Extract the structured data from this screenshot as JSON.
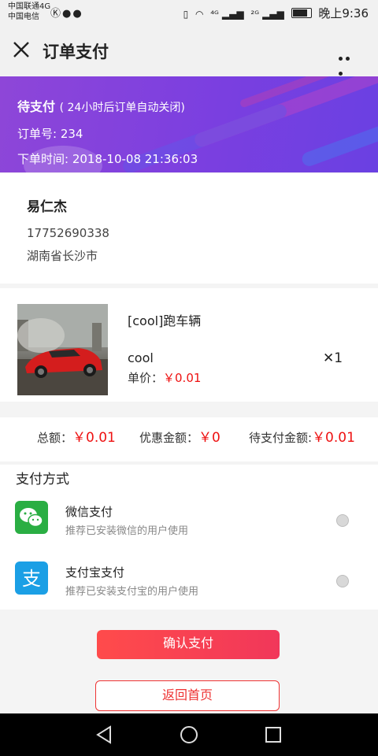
{
  "status_bar": {
    "carrier1": "中国联通4G",
    "carrier2": "中国电信",
    "time": "晚上9:36",
    "signal1": "⁴ᴳ",
    "signal2": "²ᴳ"
  },
  "header": {
    "title": "订单支付"
  },
  "banner": {
    "status": "待支付",
    "status_note": "( 24小时后订单自动关闭)",
    "order_no": "订单号: 234",
    "order_time": "下单时间: 2018-10-08 21:36:03"
  },
  "address": {
    "name": "易仁杰",
    "phone": "17752690338",
    "region": "湖南省长沙市"
  },
  "product": {
    "name": "[cool]跑车辆",
    "sub": "cool",
    "price_label": "单价：",
    "price": "￥0.01",
    "qty": "✕1"
  },
  "totals": {
    "total_label": "总额：",
    "total_value": "￥0.01",
    "discount_label": "优惠金额：",
    "discount_value": "￥0",
    "due_label": "待支付金额:",
    "due_value": "￥0.01"
  },
  "payment": {
    "title": "支付方式",
    "methods": [
      {
        "name": "微信支付",
        "desc": "推荐已安装微信的用户使用",
        "icon": "wechat-icon",
        "color": "#2aae43"
      },
      {
        "name": "支付宝支付",
        "desc": "推荐已安装支付宝的用户使用",
        "icon": "alipay-icon",
        "color": "#1b9fe5"
      }
    ]
  },
  "buttons": {
    "confirm": "确认支付",
    "home": "返回首页"
  },
  "colors": {
    "accent_red": "#ee1111",
    "banner_purple": "#7b3fe0",
    "wechat_green": "#2aae43",
    "alipay_blue": "#1b9fe5"
  }
}
